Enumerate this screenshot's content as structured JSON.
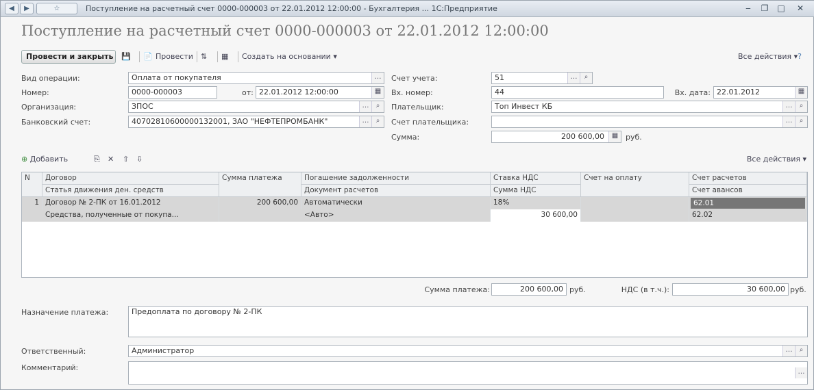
{
  "window": {
    "title": "Поступление на расчетный счет 0000-000003 от 22.01.2012 12:00:00 - Бухгалтерия ... 1С:Предприятие"
  },
  "doc_title": "Поступление на расчетный счет 0000-000003 от 22.01.2012 12:00:00",
  "toolbar": {
    "post_close": "Провести и закрыть",
    "post": "Провести",
    "create_based": "Создать на основании",
    "all_actions": "Все действия"
  },
  "form": {
    "op_label": "Вид операции:",
    "op_value": "Оплата от покупателя",
    "number_label": "Номер:",
    "number_value": "0000-000003",
    "date_prefix": "от:",
    "date_value": "22.01.2012 12:00:00",
    "org_label": "Организация:",
    "org_value": "ЗПОС",
    "bank_label": "Банковский счет:",
    "bank_value": "40702810600000132001, ЗАО \"НЕФТЕПРОМБАНК\"",
    "account_label": "Счет учета:",
    "account_value": "51",
    "incoming_num_label": "Вх. номер:",
    "incoming_num_value": "44",
    "incoming_date_label": "Вх. дата:",
    "incoming_date_value": "22.01.2012",
    "payer_label": "Плательщик:",
    "payer_value": "Топ Инвест КБ",
    "payer_account_label": "Счет плательщика:",
    "payer_account_value": "",
    "sum_label": "Сумма:",
    "sum_value": "200 600,00",
    "currency": "руб."
  },
  "grid_toolbar": {
    "add": "Добавить",
    "all_actions": "Все действия"
  },
  "grid": {
    "headers_row1": [
      "N",
      "Договор",
      "Сумма платежа",
      "Погашение задолженности",
      "Ставка НДС",
      "Счет на оплату",
      "Счет расчетов"
    ],
    "headers_row2": [
      "",
      "Статья движения ден. средств",
      "",
      "Документ расчетов",
      "Сумма НДС",
      "",
      "Счет авансов"
    ],
    "rows": [
      {
        "n": "1",
        "contract": "Договор № 2-ПК от 16.01.2012",
        "sum": "200 600,00",
        "repayment": "Автоматически",
        "vat_rate": "18%",
        "invoice": "",
        "settle_account": "62.01",
        "article": "Средства, полученные от покупа...",
        "settle_doc": "<Авто>",
        "vat_sum": "30 600,00",
        "advance_account": "62.02"
      }
    ]
  },
  "totals": {
    "payment_label": "Сумма платежа:",
    "payment_value": "200 600,00",
    "currency": "руб.",
    "vat_label": "НДС (в т.ч.):",
    "vat_value": "30 600,00",
    "vat_currency": "руб."
  },
  "purpose": {
    "label": "Назначение платежа:",
    "value": "Предоплата по договору № 2-ПК"
  },
  "responsible": {
    "label": "Ответственный:",
    "value": "Администратор"
  },
  "comment": {
    "label": "Комментарий:",
    "value": ""
  }
}
